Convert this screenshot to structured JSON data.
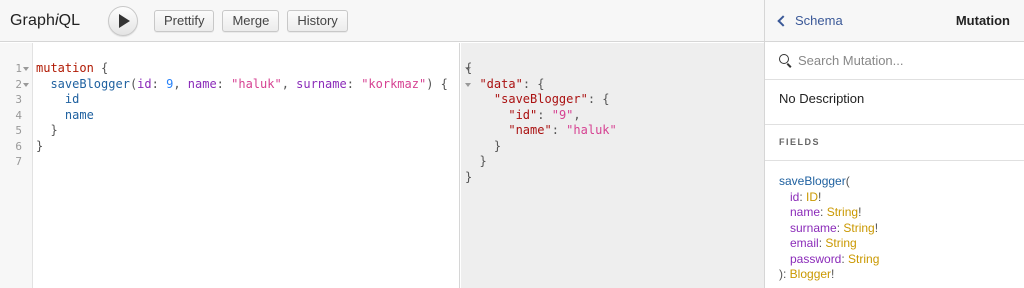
{
  "toolbar": {
    "logo_pre": "Graph",
    "logo_i": "i",
    "logo_post": "QL",
    "prettify": "Prettify",
    "merge": "Merge",
    "history": "History"
  },
  "query_editor": {
    "line_numbers": [
      "1",
      "2",
      "3",
      "4",
      "5",
      "6",
      "7"
    ],
    "lines": {
      "l1_kw": "mutation",
      "l1_brace": " {",
      "l2_field": "saveBlogger",
      "l2_arg1": "id",
      "l2_val1": "9",
      "l2_arg2": "name",
      "l2_val2": "\"haluk\"",
      "l2_arg3": "surname",
      "l2_val3": "\"korkmaz\"",
      "l2_end": ") {",
      "l3_field": "id",
      "l4_field": "name",
      "l5": "}",
      "l6": "}"
    }
  },
  "result": {
    "key_data": "\"data\"",
    "key_save": "\"saveBlogger\"",
    "key_id": "\"id\"",
    "val_id": "\"9\"",
    "key_name": "\"name\"",
    "val_name": "\"haluk\""
  },
  "docs": {
    "back_label": "Schema",
    "title": "Mutation",
    "search_placeholder": "Search Mutation...",
    "description": "No Description",
    "fields_header": "FIELDS",
    "field_name": "saveBlogger",
    "args": [
      {
        "name": "id",
        "type": "ID",
        "suffix": "!"
      },
      {
        "name": "name",
        "type": "String",
        "suffix": "!"
      },
      {
        "name": "surname",
        "type": "String",
        "suffix": "!"
      },
      {
        "name": "email",
        "type": "String",
        "suffix": ""
      },
      {
        "name": "password",
        "type": "String",
        "suffix": ""
      }
    ],
    "return_type": "Blogger",
    "return_suffix": "!"
  },
  "colors": {
    "keyword": "#b11a04",
    "field": "#1f61a0",
    "argument": "#8b2bb9",
    "number": "#2882f9",
    "string": "#d64292",
    "type": "#ca9800",
    "link": "#3b5998"
  }
}
